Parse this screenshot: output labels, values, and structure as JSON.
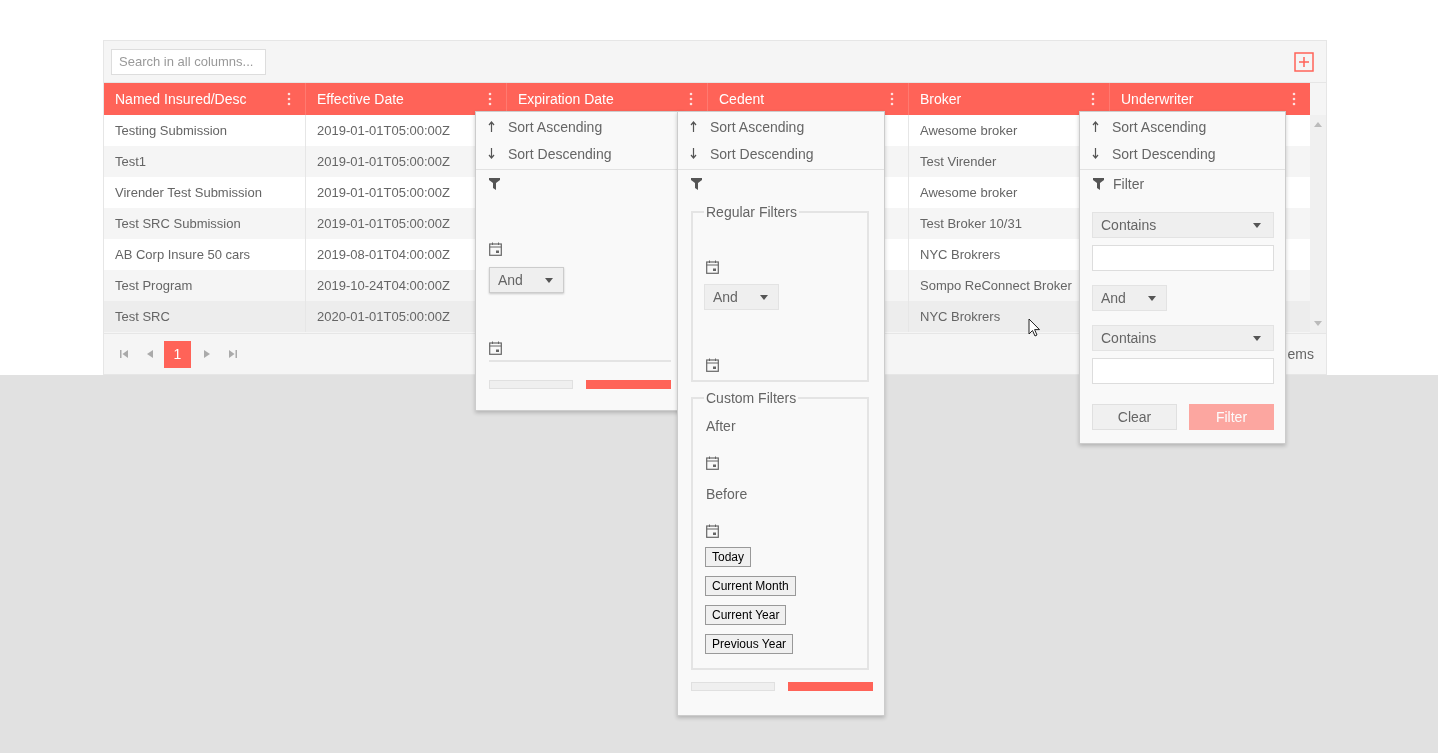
{
  "toolbar": {
    "search": {
      "placeholder": "Search in all columns..."
    }
  },
  "columns": [
    {
      "label": "Named Insured/Desc"
    },
    {
      "label": "Effective Date"
    },
    {
      "label": "Expiration Date"
    },
    {
      "label": "Cedent"
    },
    {
      "label": "Broker"
    },
    {
      "label": "Underwriter"
    }
  ],
  "rows": [
    {
      "named_insured": "Testing Submission",
      "effective_date": "2019-01-01T05:00:00Z",
      "broker": "Awesome broker"
    },
    {
      "named_insured": "Test1",
      "effective_date": "2019-01-01T05:00:00Z",
      "broker": "Test Virender"
    },
    {
      "named_insured": "Virender Test Submission",
      "effective_date": "2019-01-01T05:00:00Z",
      "broker": "Awesome broker"
    },
    {
      "named_insured": "Test SRC Submission",
      "effective_date": "2019-01-01T05:00:00Z",
      "broker": "Test Broker 10/31"
    },
    {
      "named_insured": "AB Corp Insure 50 cars",
      "effective_date": "2019-08-01T04:00:00Z",
      "broker": "NYC Brokrers"
    },
    {
      "named_insured": "Test Program",
      "effective_date": "2019-10-24T04:00:00Z",
      "broker": "Sompo ReConnect Broker"
    },
    {
      "named_insured": "Test SRC",
      "effective_date": "2020-01-01T05:00:00Z",
      "broker": "NYC Brokrers"
    }
  ],
  "pager": {
    "pages": [
      {
        "label": "1",
        "selected": true
      }
    ],
    "info": "ems"
  },
  "expiration_menu": {
    "sort": [
      "Sort Ascending",
      "Sort Descending"
    ],
    "logic": "And"
  },
  "cedent_menu": {
    "sort": [
      "Sort Ascending",
      "Sort Descending"
    ],
    "regular_filters": {
      "legend": "Regular Filters",
      "logic": "And"
    },
    "custom_filters": {
      "legend": "Custom Filters",
      "after": "After",
      "before": "Before",
      "presets": [
        "Today",
        "Current Month",
        "Current Year",
        "Previous Year"
      ]
    }
  },
  "underwriter_menu": {
    "sort": [
      "Sort Ascending",
      "Sort Descending"
    ],
    "filter_label": "Filter",
    "operators": [
      "Contains",
      "Contains"
    ],
    "logic": "And",
    "buttons": [
      {
        "label": "Clear",
        "kind": "secondary",
        "disabled": false
      },
      {
        "label": "Filter",
        "kind": "primary",
        "disabled": true
      }
    ]
  }
}
